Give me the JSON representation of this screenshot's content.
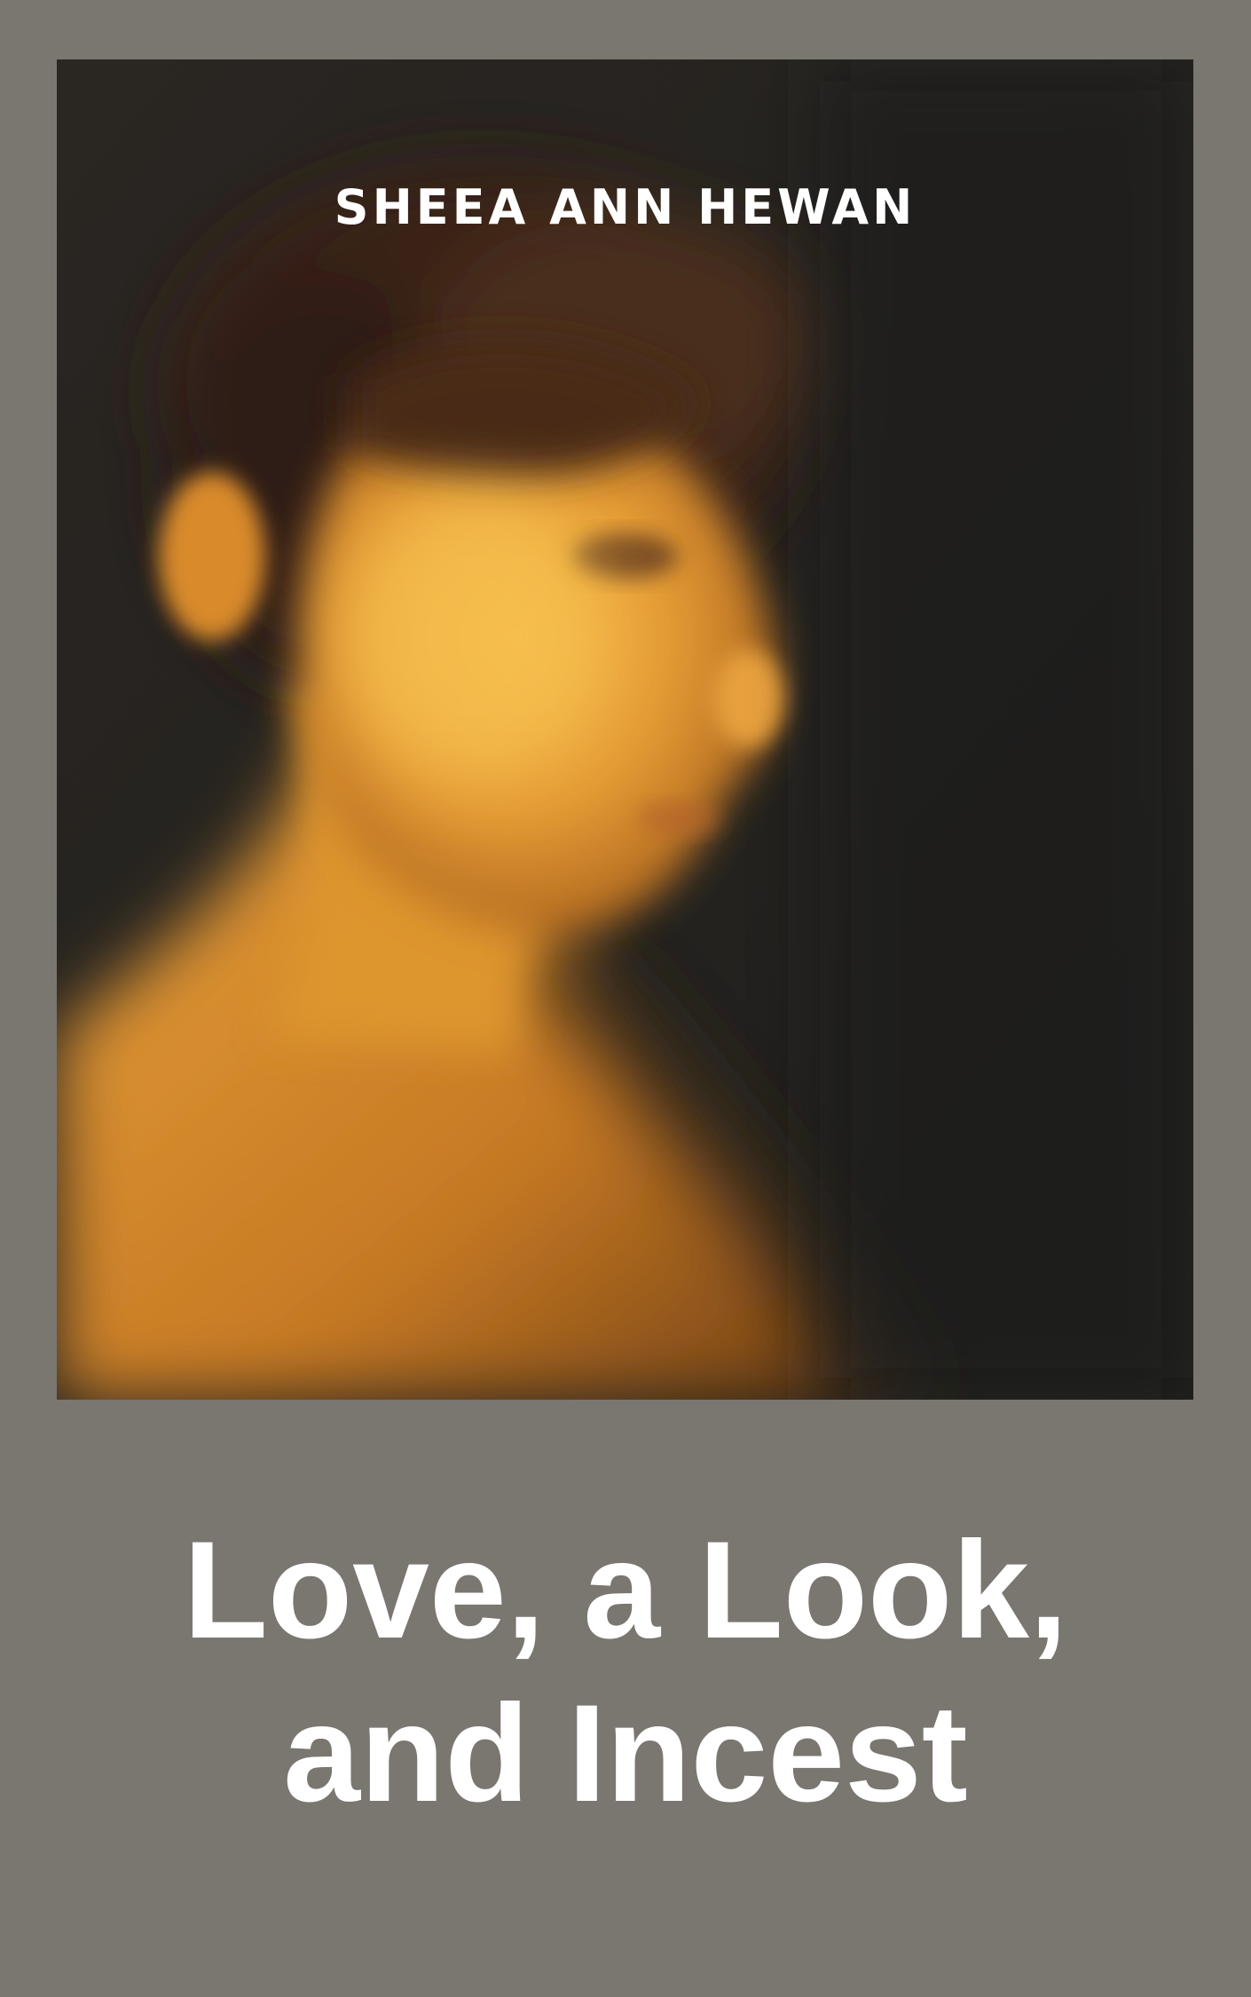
{
  "cover": {
    "author": "SHEEA ANN HEWAN",
    "title_lines": [
      "Love, a Look,",
      "and Incest"
    ]
  },
  "colors": {
    "background": "#7a7670",
    "photo_dark": "#232220",
    "skin_highlight": "#f2b445",
    "skin_mid": "#d98a2c",
    "hair": "#3a2418",
    "text": "#ffffff"
  },
  "photo": {
    "subject": "blurred-portrait-woman-profile"
  }
}
